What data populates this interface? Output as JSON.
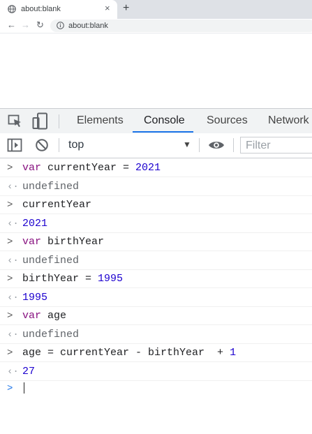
{
  "browser": {
    "tab_title": "about:blank",
    "tab_close": "×",
    "new_tab": "+",
    "address": "about:blank",
    "nav": {
      "back": "←",
      "forward": "→",
      "reload": "↻"
    }
  },
  "devtools": {
    "tabs": [
      "Elements",
      "Console",
      "Sources",
      "Network"
    ],
    "active_tab": "Console",
    "context": "top",
    "context_arrow": "▼",
    "filter_placeholder": "Filter",
    "accent": "#1a73e8"
  },
  "console": {
    "prompt_in": ">",
    "prompt_out": "‹·",
    "lines": [
      {
        "kind": "in",
        "keyword": "var",
        "rest": " currentYear = ",
        "num": "2021"
      },
      {
        "kind": "out",
        "text": "undefined"
      },
      {
        "kind": "in",
        "text": "currentYear"
      },
      {
        "kind": "out",
        "num": "2021"
      },
      {
        "kind": "in",
        "keyword": "var",
        "rest": " birthYear"
      },
      {
        "kind": "out",
        "text": "undefined"
      },
      {
        "kind": "in",
        "text": "birthYear = ",
        "num": "1995"
      },
      {
        "kind": "out",
        "num": "1995"
      },
      {
        "kind": "in",
        "keyword": "var",
        "rest": " age"
      },
      {
        "kind": "out",
        "text": "undefined"
      },
      {
        "kind": "in",
        "text": "age = currentYear - birthYear  + ",
        "num": "1"
      },
      {
        "kind": "out",
        "num": "27"
      }
    ],
    "colors": {
      "keyword": "#881280",
      "number": "#1c00cf"
    }
  }
}
